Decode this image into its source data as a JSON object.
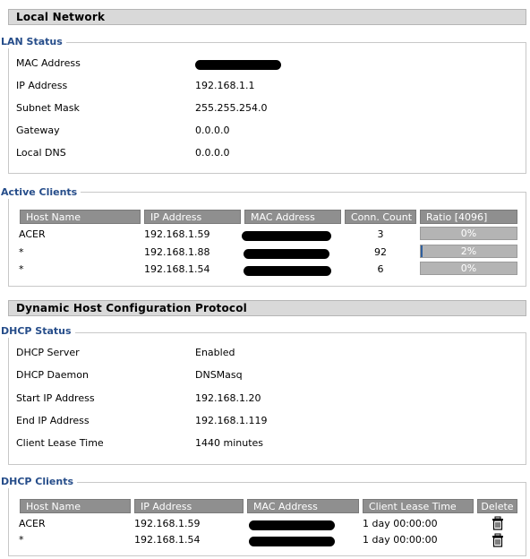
{
  "local_network": {
    "title": "Local Network"
  },
  "lan_status": {
    "legend": "LAN Status",
    "rows": [
      {
        "label": "MAC Address",
        "value": ""
      },
      {
        "label": "IP Address",
        "value": "192.168.1.1"
      },
      {
        "label": "Subnet Mask",
        "value": "255.255.254.0"
      },
      {
        "label": "Gateway",
        "value": "0.0.0.0"
      },
      {
        "label": "Local DNS",
        "value": "0.0.0.0"
      }
    ]
  },
  "active_clients": {
    "legend": "Active Clients",
    "headers": [
      "Host Name",
      "IP Address",
      "MAC Address",
      "Conn. Count",
      "Ratio [4096]"
    ],
    "rows": [
      {
        "host": "ACER",
        "ip": "192.168.1.59",
        "mac": "",
        "count": "3",
        "ratio": "0%",
        "ratio_fraction": 0.0
      },
      {
        "host": "*",
        "ip": "192.168.1.88",
        "mac": "",
        "count": "92",
        "ratio": "2%",
        "ratio_fraction": 0.02
      },
      {
        "host": "*",
        "ip": "192.168.1.54",
        "mac": "",
        "count": "6",
        "ratio": "0%",
        "ratio_fraction": 0.0
      }
    ]
  },
  "dhcp": {
    "title": "Dynamic Host Configuration Protocol"
  },
  "dhcp_status": {
    "legend": "DHCP Status",
    "rows": [
      {
        "label": "DHCP Server",
        "value": "Enabled"
      },
      {
        "label": "DHCP Daemon",
        "value": "DNSMasq"
      },
      {
        "label": "Start IP Address",
        "value": "192.168.1.20"
      },
      {
        "label": "End IP Address",
        "value": "192.168.1.119"
      },
      {
        "label": "Client Lease Time",
        "value": "1440 minutes"
      }
    ]
  },
  "dhcp_clients": {
    "legend": "DHCP Clients",
    "headers": [
      "Host Name",
      "IP Address",
      "MAC Address",
      "Client Lease Time",
      "Delete"
    ],
    "rows": [
      {
        "host": "ACER",
        "ip": "192.168.1.59",
        "mac": "",
        "lease": "1 day 00:00:00",
        "icon": "trash-icon"
      },
      {
        "host": "*",
        "ip": "192.168.1.54",
        "mac": "",
        "lease": "1 day 00:00:00",
        "icon": "trash-icon"
      }
    ]
  },
  "colors": {
    "legend": "#264d8a",
    "header_bg": "#d9d9d9",
    "table_header_bg": "#8f8f8f",
    "ratio_fill": "#2f5f9d"
  }
}
